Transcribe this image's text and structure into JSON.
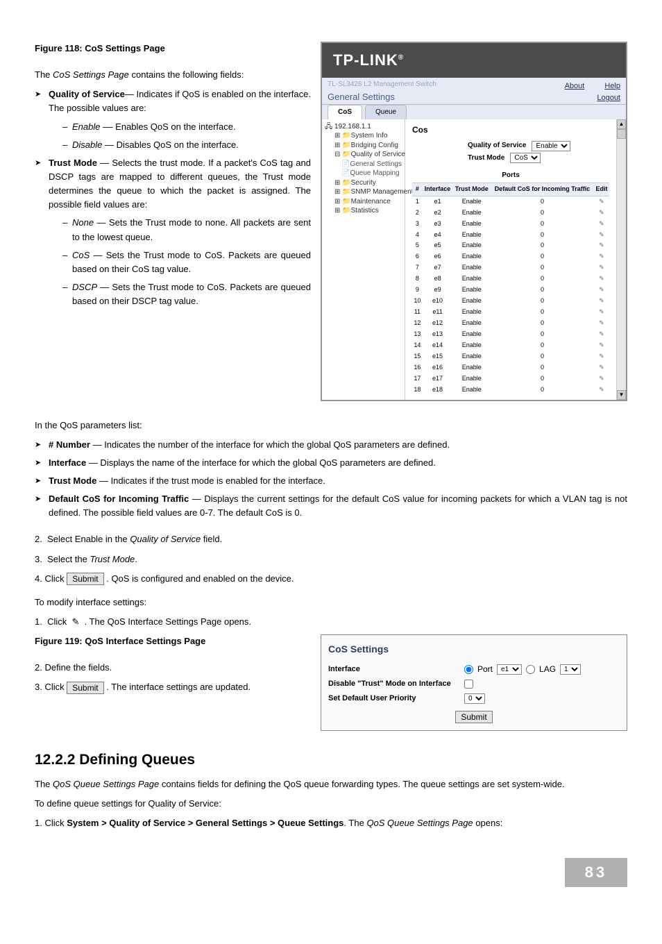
{
  "fig118": "Figure 118: CoS Settings Page",
  "intro118": "The CoS Settings Page contains the following fields:",
  "qos_term": "Quality of Service",
  "qos_desc": "— Indicates if QoS is enabled on the interface. The possible values are:",
  "qos_enable_t": "Enable",
  "qos_enable_d": " –– Enables QoS on the interface.",
  "qos_disable_t": "Disable",
  "qos_disable_d": " — Disables QoS on the interface.",
  "tm_term": "Trust Mode",
  "tm_desc": " — Selects the trust mode. If a packet's CoS tag and DSCP tags are mapped to different queues, the Trust mode determines the queue to which the packet is assigned. The possible field values are:",
  "tm_none_t": "None",
  "tm_none_d": " — Sets the Trust mode to none. All packets are sent to the lowest queue.",
  "tm_cos_t": "CoS",
  "tm_cos_d": " — Sets the Trust mode to CoS. Packets are queued based on their CoS tag value.",
  "tm_dscp_t": "DSCP",
  "tm_dscp_d": " — Sets the Trust mode to CoS. Packets are queued based on their DSCP tag value.",
  "paramlist_intro": "In the QoS parameters list:",
  "p_num_t": "# Number",
  "p_num_d": " — Indicates the number of the interface for which the global QoS parameters are defined.",
  "p_if_t": "Interface",
  "p_if_d": " — Displays the name of the interface for which the global QoS parameters are defined.",
  "p_tm_t": "Trust Mode",
  "p_tm_d": " — Indicates if the trust mode is enabled for the interface.",
  "p_def_t": "Default CoS for Incoming Traffic",
  "p_def_d": " — Displays the current settings for the default CoS value for incoming packets for which a VLAN tag is not defined. The possible field values are 0-7. The default CoS is 0.",
  "step2": "2.  Select Enable in the Quality of Service field.",
  "step2_em": "Quality of Service",
  "step3": "3.  Select the Trust Mode.",
  "step3_em": "Trust Mode",
  "step4a": "4.  Click ",
  "step4b": ". QoS is configured and enabled on the device.",
  "submit_label": "Submit",
  "modify_intro": "To modify interface settings:",
  "modify_step1": "1.  Click  ✎  . The QoS Interface Settings Page opens.",
  "fig119": "Figure 119: QoS Interface Settings Page",
  "def_fields": "2.  Define the fields.",
  "apply_a": "3.  Click ",
  "apply_b": ". The interface settings are updated.",
  "cos_settings_title": "CoS Settings",
  "cos_if_label": "Interface",
  "cos_port_label": "Port",
  "cos_port_val": "e1",
  "cos_lag_label": "LAG",
  "cos_lag_val": "1",
  "cos_dis_label": "Disable \"Trust\" Mode on Interface",
  "cos_set_label": "Set Default User Priority",
  "cos_set_val": "0",
  "sec_heading": "12.2.2  Defining Queues",
  "sec_p1a": "The ",
  "sec_p1_em": "QoS Queue Settings Page",
  "sec_p1b": " contains fields for defining the QoS queue forwarding types. The queue settings are set system-wide.",
  "sec_p2": "To define queue settings for Quality of Service:",
  "sec_step1a": "1.  Click ",
  "sec_step1_path": "System > Quality of Service > General Settings > Queue Settings",
  "sec_step1b": ". The ",
  "sec_step1_em": "QoS Queue Settings Page",
  "sec_step1c": " opens:",
  "page_number": "83",
  "panel": {
    "brand": "TP-LINK",
    "title": "General Settings",
    "subtitle": "TL-SL3428 L2 Management Switch",
    "about": "About",
    "help": "Help",
    "logout": "Logout",
    "tabs": {
      "cos": "CoS",
      "queue": "Queue"
    },
    "tree": {
      "root": "192.168.1.1",
      "n1": "System Info",
      "n2": "Bridging Config",
      "n3": "Quality of Service",
      "n3a": "General Settings",
      "n3b": "Queue Mapping",
      "n4": "Security",
      "n5": "SNMP Management",
      "n6": "Maintenance",
      "n7": "Statistics"
    },
    "cos_label": "Cos",
    "form": {
      "qos_label": "Quality of Service",
      "qos_val": "Enable",
      "tm_label": "Trust Mode",
      "tm_val": "CoS"
    },
    "ports_title": "Ports",
    "ports_cols": {
      "c1": "#",
      "c2": "Interface",
      "c3": "Trust Mode",
      "c4": "Default CoS for Incoming Traffic",
      "c5": "Edit"
    },
    "rows": [
      {
        "n": "1",
        "if": "e1",
        "tm": "Enable",
        "d": "0"
      },
      {
        "n": "2",
        "if": "e2",
        "tm": "Enable",
        "d": "0"
      },
      {
        "n": "3",
        "if": "e3",
        "tm": "Enable",
        "d": "0"
      },
      {
        "n": "4",
        "if": "e4",
        "tm": "Enable",
        "d": "0"
      },
      {
        "n": "5",
        "if": "e5",
        "tm": "Enable",
        "d": "0"
      },
      {
        "n": "6",
        "if": "e6",
        "tm": "Enable",
        "d": "0"
      },
      {
        "n": "7",
        "if": "e7",
        "tm": "Enable",
        "d": "0"
      },
      {
        "n": "8",
        "if": "e8",
        "tm": "Enable",
        "d": "0"
      },
      {
        "n": "9",
        "if": "e9",
        "tm": "Enable",
        "d": "0"
      },
      {
        "n": "10",
        "if": "e10",
        "tm": "Enable",
        "d": "0"
      },
      {
        "n": "11",
        "if": "e11",
        "tm": "Enable",
        "d": "0"
      },
      {
        "n": "12",
        "if": "e12",
        "tm": "Enable",
        "d": "0"
      },
      {
        "n": "13",
        "if": "e13",
        "tm": "Enable",
        "d": "0"
      },
      {
        "n": "14",
        "if": "e14",
        "tm": "Enable",
        "d": "0"
      },
      {
        "n": "15",
        "if": "e15",
        "tm": "Enable",
        "d": "0"
      },
      {
        "n": "16",
        "if": "e16",
        "tm": "Enable",
        "d": "0"
      },
      {
        "n": "17",
        "if": "e17",
        "tm": "Enable",
        "d": "0"
      },
      {
        "n": "18",
        "if": "e18",
        "tm": "Enable",
        "d": "0"
      }
    ]
  }
}
